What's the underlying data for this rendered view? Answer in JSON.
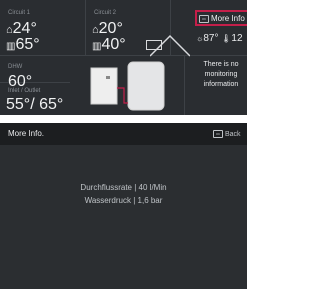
{
  "circuit1": {
    "label": "Circuit 1",
    "room_temp": "24°",
    "flow_temp": "65°"
  },
  "circuit2": {
    "label": "Circuit 2",
    "room_temp": "20°",
    "flow_temp": "40°"
  },
  "dhw": {
    "label": "DHW",
    "temp": "60°"
  },
  "inlet_outlet": {
    "label": "Inlet / Outlet",
    "value": "55°/ 65°"
  },
  "more_info_button": {
    "label": "More Info"
  },
  "outdoor_readout": {
    "value1": "87°",
    "value2": "12"
  },
  "monitoring_note": "There is no monitoring information",
  "more_info_screen": {
    "title": "More Info.",
    "back_label": "Back",
    "lines": [
      {
        "label": "Durchflussrate",
        "sep": "|",
        "value": "40 l/Min"
      },
      {
        "label": "Wasserdruck",
        "sep": "|",
        "value": "1,6 bar"
      }
    ]
  },
  "colors": {
    "highlight": "#c41f4a",
    "panel": "#2a2d31",
    "text": "#e9eaec"
  }
}
